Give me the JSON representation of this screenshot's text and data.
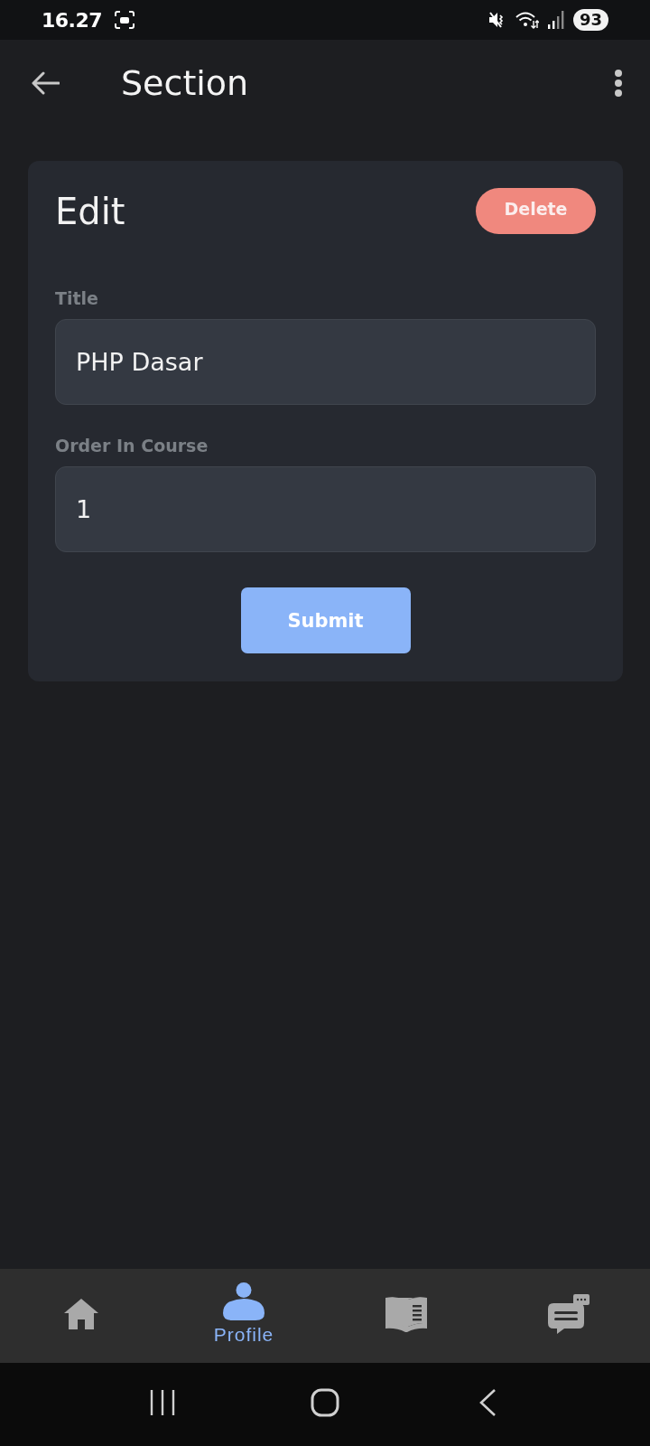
{
  "status_bar": {
    "time": "16.27",
    "battery": "93"
  },
  "app_bar": {
    "title": "Section"
  },
  "form": {
    "heading": "Edit",
    "delete_button": "Delete",
    "fields": [
      {
        "label": "Title",
        "value": "PHP Dasar"
      },
      {
        "label": "Order In Course",
        "value": "1"
      }
    ],
    "submit_button": "Submit"
  },
  "bottom_nav": [
    {
      "kind": "home",
      "selected": false
    },
    {
      "kind": "profile",
      "label": "Profile",
      "selected": true
    },
    {
      "kind": "book",
      "selected": false
    },
    {
      "kind": "chat",
      "selected": false
    }
  ]
}
